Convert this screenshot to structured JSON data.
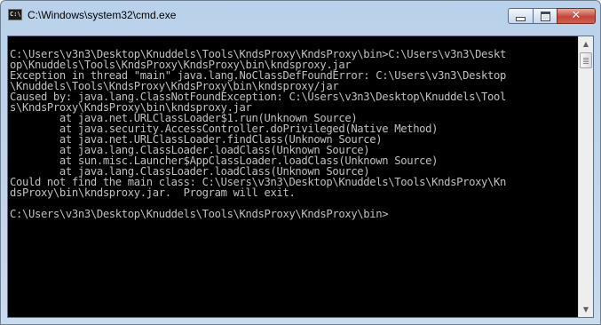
{
  "window": {
    "title": "C:\\Windows\\system32\\cmd.exe",
    "icon": "cmd-app-icon",
    "icon_text": "C:\\",
    "controls": {
      "minimize_icon": "minimize-icon",
      "maximize_icon": "maximize-icon",
      "close_icon": "close-icon",
      "close_glyph": "✕"
    }
  },
  "console": {
    "foreground_color": "#c0c0c0",
    "background_color": "#000000",
    "lines": [
      "",
      "C:\\Users\\v3n3\\Desktop\\Knuddels\\Tools\\KndsProxy\\KndsProxy\\bin>C:\\Users\\v3n3\\Deskt",
      "op\\Knuddels\\Tools\\KndsProxy\\KndsProxy\\bin\\kndsproxy.jar",
      "Exception in thread \"main\" java.lang.NoClassDefFoundError: C:\\Users\\v3n3\\Desktop",
      "\\Knuddels\\Tools\\KndsProxy\\KndsProxy\\bin\\kndsproxy/jar",
      "Caused by: java.lang.ClassNotFoundException: C:\\Users\\v3n3\\Desktop\\Knuddels\\Tool",
      "s\\KndsProxy\\KndsProxy\\bin\\kndsproxy.jar",
      "        at java.net.URLClassLoader$1.run(Unknown Source)",
      "        at java.security.AccessController.doPrivileged(Native Method)",
      "        at java.net.URLClassLoader.findClass(Unknown Source)",
      "        at java.lang.ClassLoader.loadClass(Unknown Source)",
      "        at sun.misc.Launcher$AppClassLoader.loadClass(Unknown Source)",
      "        at java.lang.ClassLoader.loadClass(Unknown Source)",
      "Could not find the main class: C:\\Users\\v3n3\\Desktop\\Knuddels\\Tools\\KndsProxy\\Kn",
      "dsProxy\\bin\\kndsproxy.jar.  Program will exit.",
      "",
      "C:\\Users\\v3n3\\Desktop\\Knuddels\\Tools\\KndsProxy\\KndsProxy\\bin>"
    ]
  },
  "scrollbar": {
    "up_icon": "scroll-up-arrow-icon",
    "down_icon": "scroll-down-arrow-icon",
    "up_glyph": "▲",
    "down_glyph": "▼",
    "position_fraction": 0.0
  }
}
